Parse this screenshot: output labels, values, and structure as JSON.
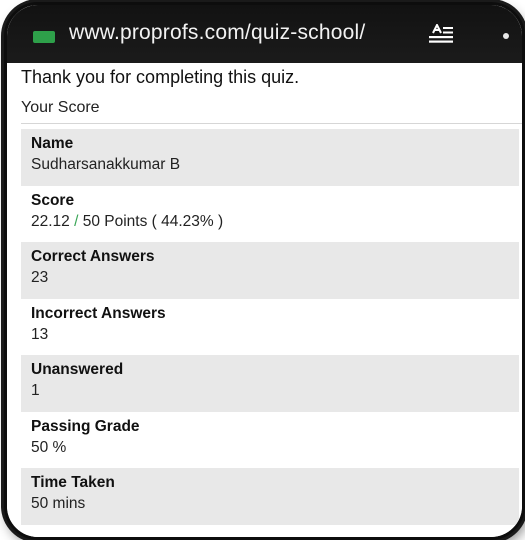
{
  "browser": {
    "url": "www.proprofs.com/quiz-school/",
    "reader_icon": "reader-mode-icon",
    "menu_icon": "overflow-menu-icon"
  },
  "page": {
    "thanks": "Thank you for completing this quiz.",
    "heading": "Your Score"
  },
  "results": {
    "name": {
      "label": "Name",
      "value": "Sudharsanakkumar B"
    },
    "score": {
      "label": "Score",
      "earned": "22.12",
      "slash": "/",
      "rest": "50   Points ( 44.23% )"
    },
    "correct": {
      "label": "Correct Answers",
      "value": "23"
    },
    "incorrect": {
      "label": "Incorrect Answers",
      "value": "13"
    },
    "unanswered": {
      "label": "Unanswered",
      "value": "1"
    },
    "passing": {
      "label": "Passing Grade",
      "value": "50 %"
    },
    "time": {
      "label": "Time Taken",
      "value": "50 mins"
    }
  },
  "colors": {
    "url_bar": "#121212",
    "row_shade": "#e8e8e8",
    "accent": "#3aa657"
  }
}
